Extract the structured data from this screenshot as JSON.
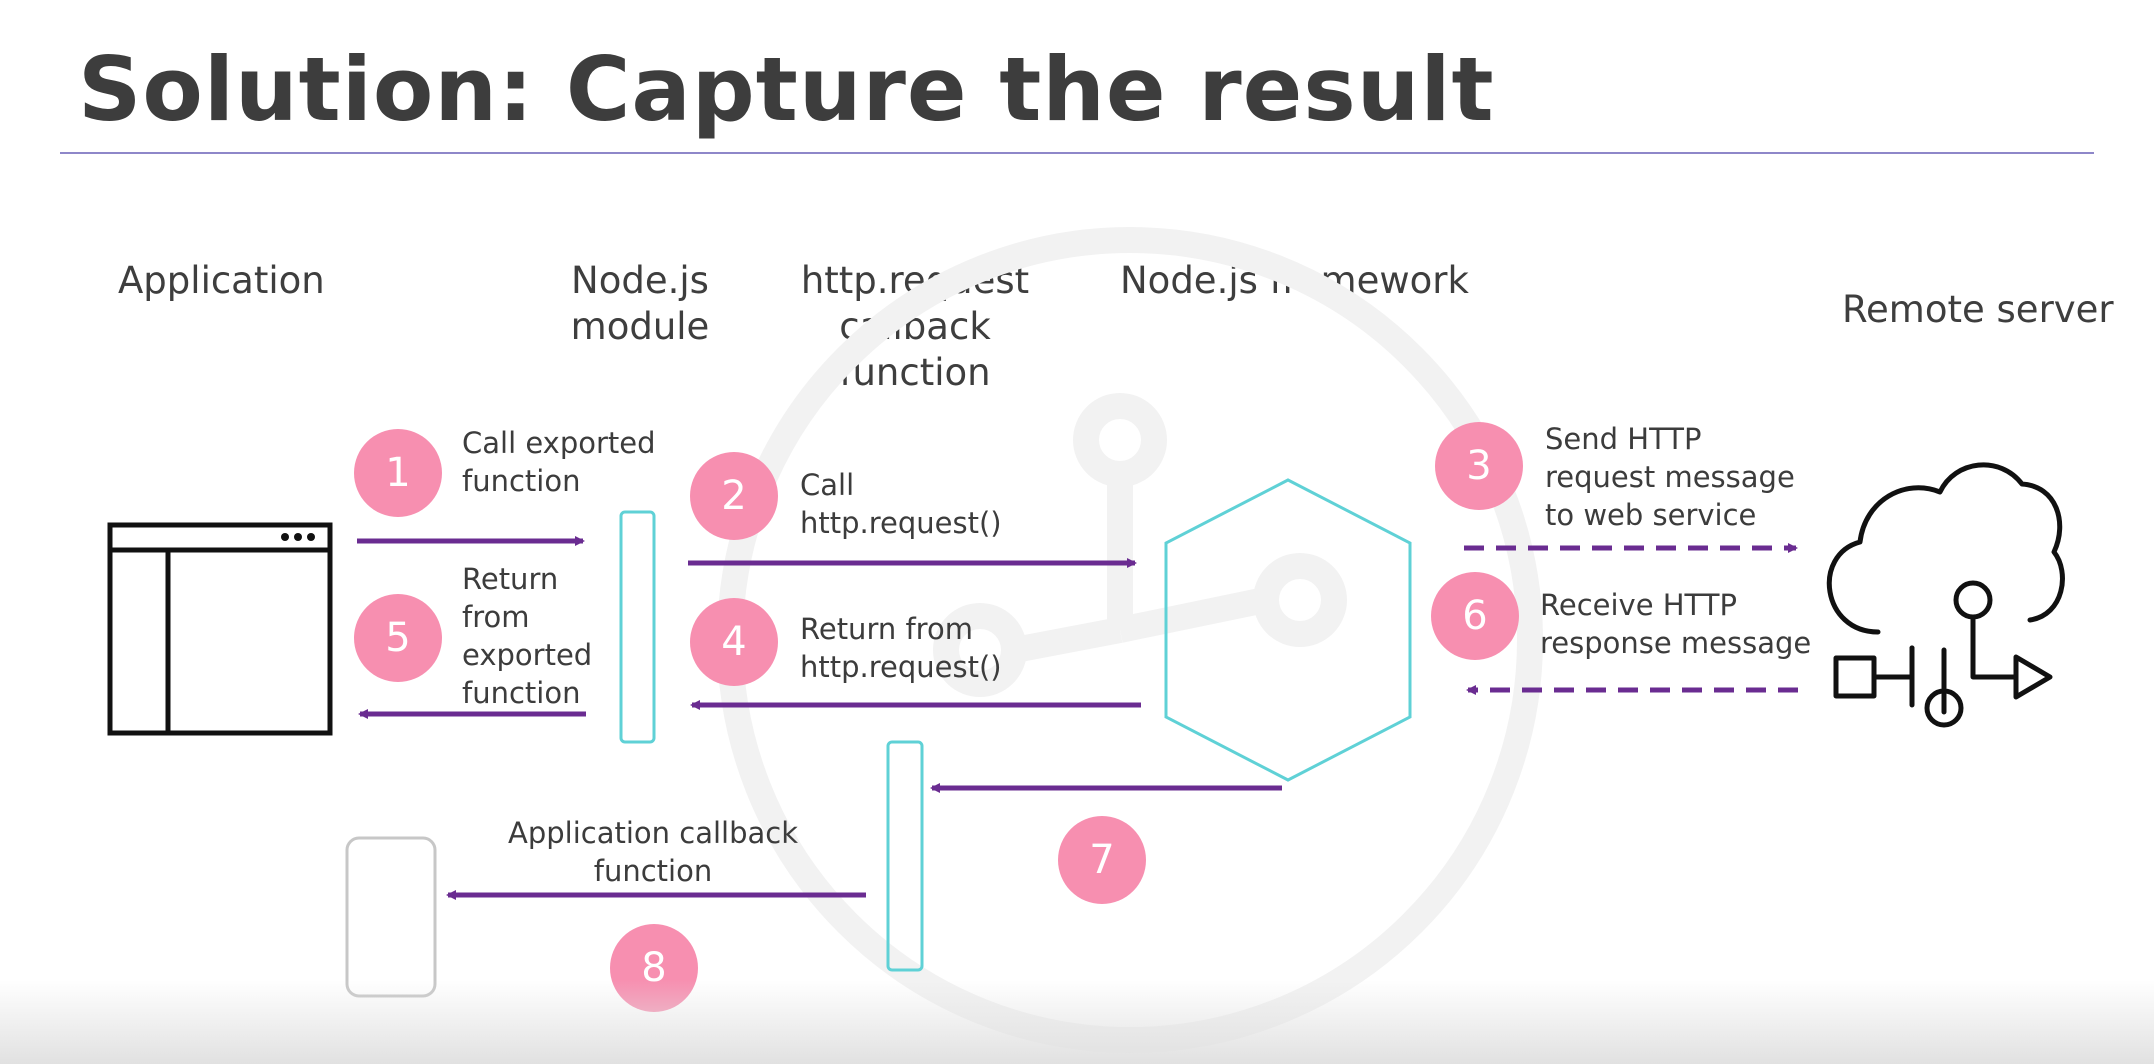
{
  "title": "Solution: Capture the result",
  "headings": {
    "application": "Application",
    "node_module": "Node.js\nmodule",
    "http_callback": "http.request\ncallback function",
    "node_framework": "Node.js framework",
    "remote_server": "Remote server"
  },
  "steps": [
    {
      "number": "1",
      "label": "Call exported\nfunction"
    },
    {
      "number": "2",
      "label": "Call\nhttp.request()"
    },
    {
      "number": "3",
      "label": "Send HTTP\nrequest message\nto web service"
    },
    {
      "number": "4",
      "label": "Return from\nhttp.request()"
    },
    {
      "number": "5",
      "label": "Return\nfrom\nexported\nfunction"
    },
    {
      "number": "6",
      "label": "Receive HTTP\nresponse message"
    },
    {
      "number": "7",
      "label": ""
    },
    {
      "number": "8",
      "label": "Application callback\nfunction"
    }
  ],
  "colors": {
    "arrow": "#6a2c91",
    "badge": "#f78fb0",
    "module_outline": "#5fd1d6",
    "rule": "#8e87c9"
  },
  "icons": {
    "application": "app-window-icon",
    "framework": "hexagon-icon",
    "remote_server": "cloud-network-icon",
    "callback": "rounded-rectangle-icon"
  }
}
